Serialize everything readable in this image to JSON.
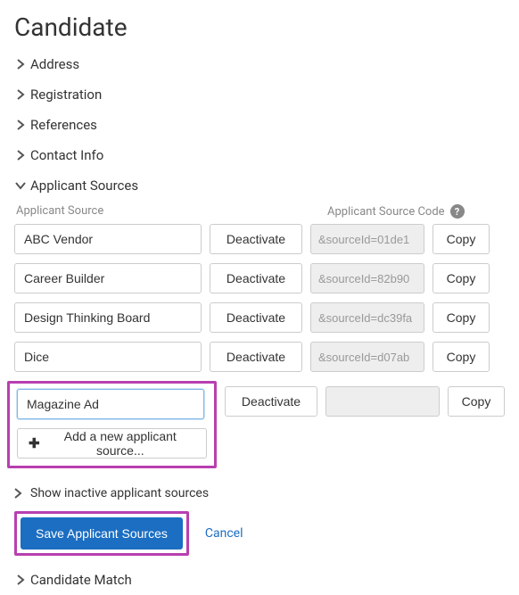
{
  "page_title": "Candidate",
  "sections": {
    "address": "Address",
    "registration": "Registration",
    "references": "References",
    "contact_info": "Contact Info",
    "applicant_sources": "Applicant Sources",
    "candidate_match": "Candidate Match"
  },
  "applicant_sources": {
    "header_source": "Applicant Source",
    "header_code": "Applicant Source Code",
    "rows": [
      {
        "name": "ABC Vendor",
        "code": "&sourceId=01de1"
      },
      {
        "name": "Career Builder",
        "code": "&sourceId=82b90"
      },
      {
        "name": "Design Thinking Board",
        "code": "&sourceId=dc39fa"
      },
      {
        "name": "Dice",
        "code": "&sourceId=d07ab"
      },
      {
        "name": "Magazine Ad",
        "code": ""
      }
    ],
    "deactivate_label": "Deactivate",
    "copy_label": "Copy",
    "add_label": "Add a new applicant source...",
    "show_inactive_label": "Show inactive applicant sources",
    "save_label": "Save Applicant Sources",
    "cancel_label": "Cancel"
  }
}
